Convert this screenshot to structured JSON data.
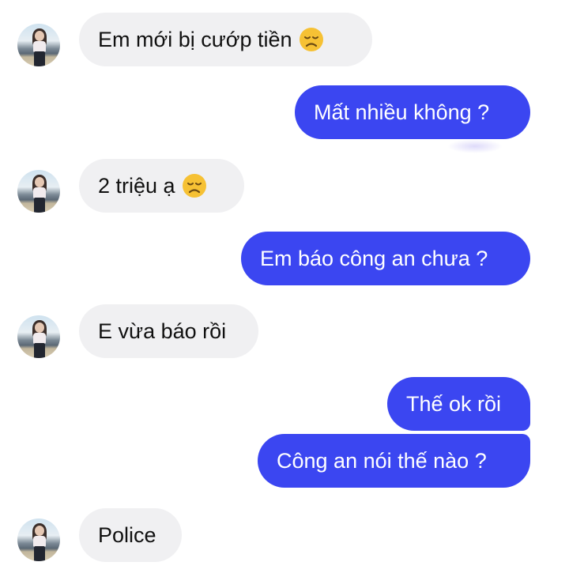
{
  "conversation": {
    "messages": [
      {
        "sender": "contact",
        "text": "Em mới bị cướp tiền",
        "emoji": "disappointed-face-icon"
      },
      {
        "sender": "me",
        "text": "Mất nhiều không ?"
      },
      {
        "sender": "contact",
        "text": "2 triệu ạ",
        "emoji": "disappointed-face-icon"
      },
      {
        "sender": "me",
        "text": "Em báo công an chưa ?"
      },
      {
        "sender": "contact",
        "text": "E vừa báo rồi"
      },
      {
        "sender": "me",
        "text": "Thế ok rồi"
      },
      {
        "sender": "me",
        "text": "Công an nói thế nào ?"
      },
      {
        "sender": "contact",
        "text": "Police"
      }
    ]
  },
  "colors": {
    "incoming_bubble": "#f0f0f2",
    "outgoing_bubble": "#3b46f1",
    "incoming_text": "#101010",
    "outgoing_text": "#ffffff",
    "emoji_fill": "#f6c134"
  }
}
